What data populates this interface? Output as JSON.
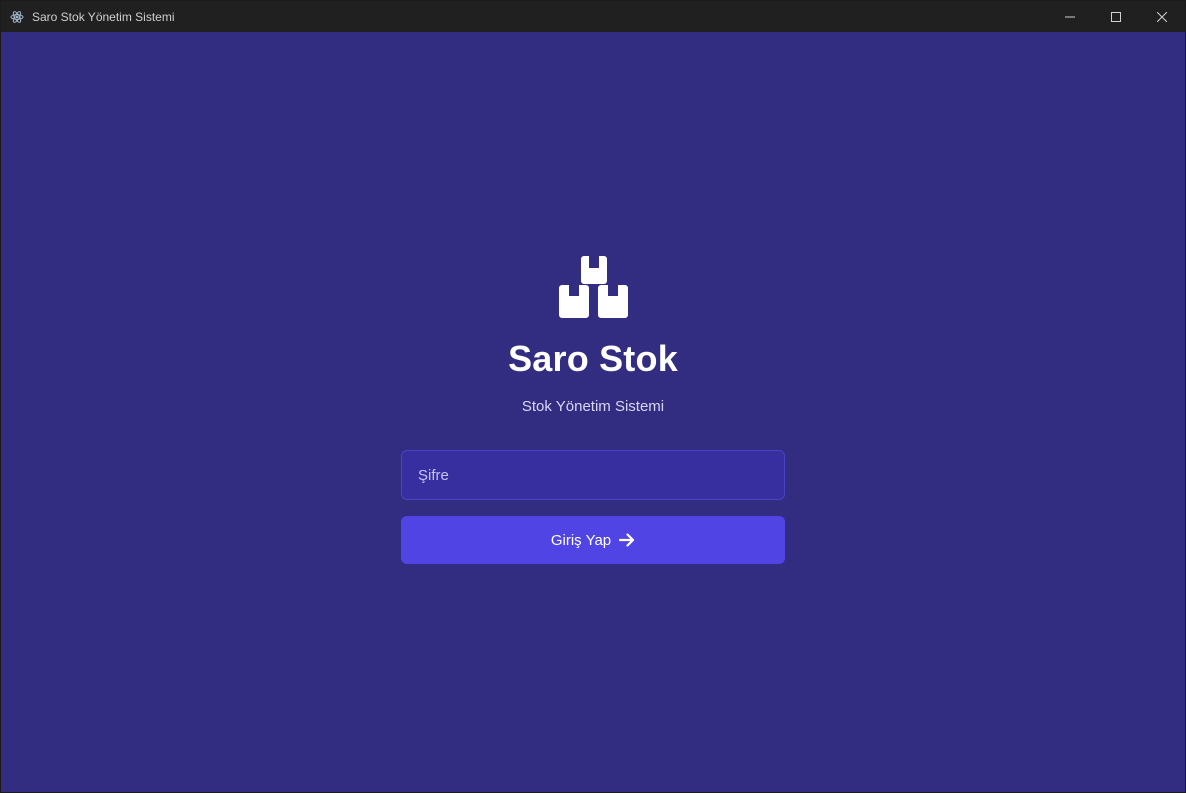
{
  "window": {
    "title": "Saro Stok Yönetim Sistemi",
    "app_icon": "electron-icon",
    "controls": [
      "minimize-icon",
      "maximize-icon",
      "close-icon"
    ]
  },
  "login": {
    "logo_icon": "boxes-icon",
    "app_name": "Saro Stok",
    "subtitle": "Stok Yönetim Sistemi",
    "password_placeholder": "Şifre",
    "password_value": "",
    "login_label": "Giriş Yap",
    "login_icon": "arrow-right-icon"
  },
  "colors": {
    "background": "#322d81",
    "input_background": "#372fa0",
    "button": "#5044e5",
    "titlebar": "#202020"
  }
}
